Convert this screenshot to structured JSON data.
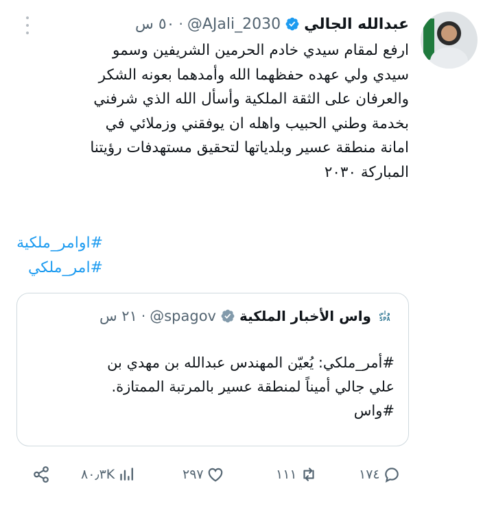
{
  "tweet": {
    "author_name": "عبدالله الجالي",
    "handle": "@AJali_2030",
    "time": "٥٠ س",
    "text_lines": [
      "ارفع لمقام سيدي خادم الحرمين الشريفين وسمو",
      "سيدي ولي عهده حفظهما الله وأمدهما بعونه الشكر",
      "والعرفان على الثقة الملكية وأسأل الله الذي شرفني",
      "بخدمة وطني الحبيب واهله ان يوفقني وزملائي في",
      "امانة منطقة عسير وبلدياتها لتحقيق مستهدفات رؤيتنا",
      "المباركة ٢٠٣٠"
    ],
    "hashtags": [
      "#اوامر_ملكية",
      "#امر_ملكي"
    ]
  },
  "quote": {
    "logo_top": "واس",
    "logo_bottom": "SPA",
    "author_name": "واس الأخبار الملكية",
    "handle": "@spagov",
    "time": "٢١ س",
    "text_lines": [
      "#أمر_ملكي: يُعيّن المهندس عبدالله بن مهدي بن",
      "علي جالي أميناً لمنطقة عسير بالمرتبة الممتازة.",
      "#واس"
    ]
  },
  "actions": {
    "replies": "١٧٤",
    "retweets": "١١١",
    "likes": "٢٩٧",
    "views": "٨٠٫٣K"
  },
  "colors": {
    "accent": "#1d9bf0",
    "secondary_text": "#536471",
    "border": "#cfd9de"
  },
  "icons": [
    "verified-badge-icon",
    "gray-verified-badge-icon",
    "more-icon",
    "reply-icon",
    "retweet-icon",
    "like-icon",
    "views-icon",
    "share-icon"
  ]
}
